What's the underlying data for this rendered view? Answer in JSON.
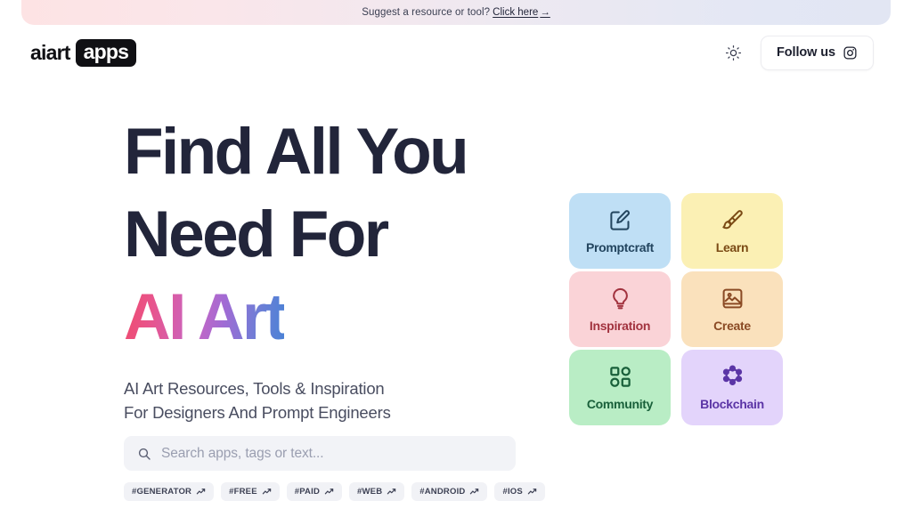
{
  "banner": {
    "text": "Suggest a resource or tool?",
    "link_label": "Click here",
    "arrow": "→",
    "gradient_from": "#fde3e4",
    "gradient_to": "#e2e6f3"
  },
  "header": {
    "logo_word": "aiart",
    "logo_badge": "apps",
    "theme_icon": "sun-icon",
    "follow_label": "Follow us",
    "social_icon": "instagram-icon"
  },
  "hero": {
    "line1": "Find All You",
    "line2": "Need For",
    "line3_gradient": "AI Art",
    "gradient_start": "#ef4b6d",
    "gradient_mid": "#a06bd4",
    "gradient_end": "#4a82d6",
    "heading_color": "#22253a",
    "subtitle_line1": "AI Art Resources, Tools & Inspiration",
    "subtitle_line2": "For Designers And Prompt Engineers"
  },
  "search": {
    "icon": "search-icon",
    "placeholder": "Search apps, tags or text...",
    "value": ""
  },
  "tags": [
    {
      "label": "#GENERATOR",
      "icon": "trending-up-icon"
    },
    {
      "label": "#FREE",
      "icon": "trending-up-icon"
    },
    {
      "label": "#PAID",
      "icon": "trending-up-icon"
    },
    {
      "label": "#WEB",
      "icon": "trending-up-icon"
    },
    {
      "label": "#ANDROID",
      "icon": "trending-up-icon"
    },
    {
      "label": "#IOS",
      "icon": "trending-up-icon"
    }
  ],
  "categories": [
    {
      "label": "Promptcraft",
      "icon": "edit-square-icon",
      "bg": "#bfdff5",
      "fg": "#23455f"
    },
    {
      "label": "Learn",
      "icon": "paint-brush-icon",
      "bg": "#fbf0b4",
      "fg": "#7b4b15"
    },
    {
      "label": "Inspiration",
      "icon": "lightbulb-icon",
      "bg": "#fad3d7",
      "fg": "#a2333f"
    },
    {
      "label": "Create",
      "icon": "image-icon",
      "bg": "#fae1bc",
      "fg": "#8a4a24"
    },
    {
      "label": "Community",
      "icon": "grid-shapes-icon",
      "bg": "#b9edc5",
      "fg": "#19603a"
    },
    {
      "label": "Blockchain",
      "icon": "network-nodes-icon",
      "bg": "#e3d4fb",
      "fg": "#5b35a6"
    }
  ]
}
